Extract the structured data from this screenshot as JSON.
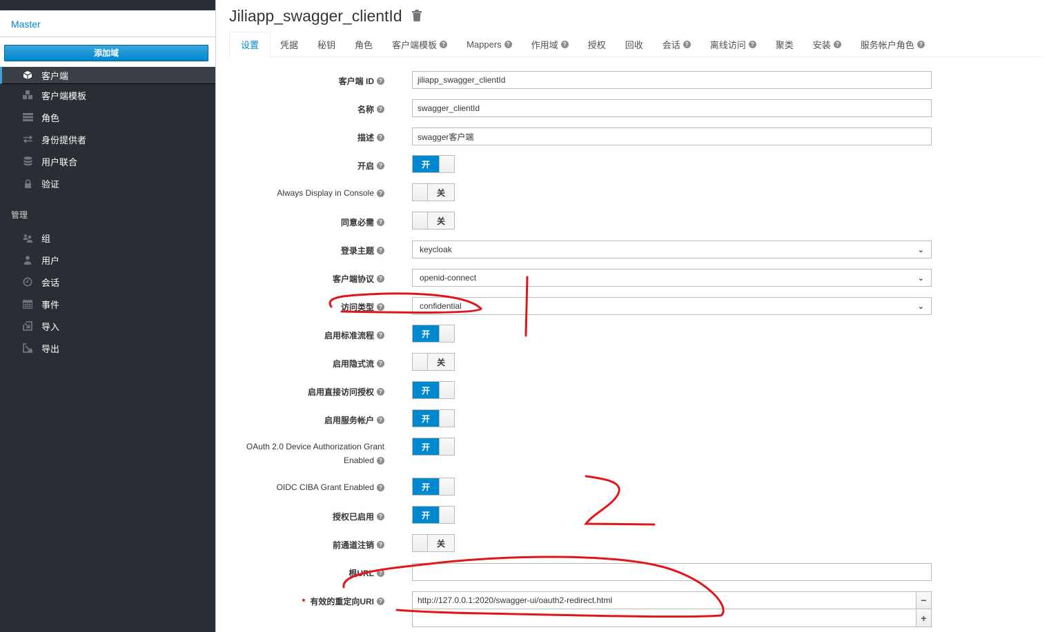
{
  "sidebar": {
    "realm": "Master",
    "add_realm_label": "添加域",
    "configure_items": [
      {
        "label": "客户端",
        "icon": "cube-icon",
        "active": true
      },
      {
        "label": "客户端模板",
        "icon": "cubes-icon"
      },
      {
        "label": "角色",
        "icon": "list-icon"
      },
      {
        "label": "身份提供者",
        "icon": "exchange-icon"
      },
      {
        "label": "用户联合",
        "icon": "database-icon"
      },
      {
        "label": "验证",
        "icon": "lock-icon"
      }
    ],
    "manage_label": "管理",
    "manage_items": [
      {
        "label": "组",
        "icon": "users-icon"
      },
      {
        "label": "用户",
        "icon": "user-icon"
      },
      {
        "label": "会话",
        "icon": "clock-icon"
      },
      {
        "label": "事件",
        "icon": "calendar-icon"
      },
      {
        "label": "导入",
        "icon": "import-icon"
      },
      {
        "label": "导出",
        "icon": "export-icon"
      }
    ]
  },
  "header": {
    "title": "Jiliapp_swagger_clientId",
    "delete_icon": "trash-icon"
  },
  "tabs": [
    {
      "label": "设置",
      "active": true,
      "help": false
    },
    {
      "label": "凭据",
      "help": false
    },
    {
      "label": "秘钥",
      "help": false
    },
    {
      "label": "角色",
      "help": false
    },
    {
      "label": "客户端模板",
      "help": true
    },
    {
      "label": "Mappers",
      "help": true
    },
    {
      "label": "作用域",
      "help": true
    },
    {
      "label": "授权",
      "help": false
    },
    {
      "label": "回收",
      "help": false
    },
    {
      "label": "会话",
      "help": true
    },
    {
      "label": "离线访问",
      "help": true
    },
    {
      "label": "聚类",
      "help": false
    },
    {
      "label": "安装",
      "help": true
    },
    {
      "label": "服务帐户角色",
      "help": true
    }
  ],
  "help_glyph": "?",
  "form": {
    "client_id": {
      "label": "客户端 ID",
      "value": "jiliapp_swagger_clientId"
    },
    "name": {
      "label": "名称",
      "value": "swagger_clientId"
    },
    "description": {
      "label": "描述",
      "value": "swagger客户端"
    },
    "enabled": {
      "label": "开启",
      "on": true
    },
    "always_display": {
      "label": "Always Display in Console",
      "on": false
    },
    "consent_required": {
      "label": "同意必需",
      "on": false
    },
    "login_theme": {
      "label": "登录主题",
      "value": "keycloak"
    },
    "client_protocol": {
      "label": "客户端协议",
      "value": "openid-connect"
    },
    "access_type": {
      "label": "访问类型",
      "value": "confidential"
    },
    "standard_flow": {
      "label": "启用标准流程",
      "on": true
    },
    "implicit_flow": {
      "label": "启用隐式流",
      "on": false
    },
    "direct_access": {
      "label": "启用直接访问授权",
      "on": true
    },
    "service_accounts": {
      "label": "启用服务帐户",
      "on": true
    },
    "device_grant": {
      "label_line1": "OAuth 2.0 Device Authorization Grant",
      "label_line2": "Enabled",
      "on": true
    },
    "ciba_grant": {
      "label": "OIDC CIBA Grant Enabled",
      "on": true
    },
    "authorization": {
      "label": "授权已启用",
      "on": true
    },
    "front_channel_logout": {
      "label": "前通道注销",
      "on": false
    },
    "root_url": {
      "label": "根URL",
      "value": ""
    },
    "redirect_uris": {
      "label": "有效的重定向URI",
      "required_mark": "*",
      "values": [
        "http://127.0.0.1:2020/swagger-ui/oauth2-redirect.html",
        ""
      ],
      "remove_glyph": "−",
      "add_glyph": "+"
    }
  },
  "switch_labels": {
    "on": "开",
    "off": "关"
  },
  "annotation_color": "#e0161b"
}
